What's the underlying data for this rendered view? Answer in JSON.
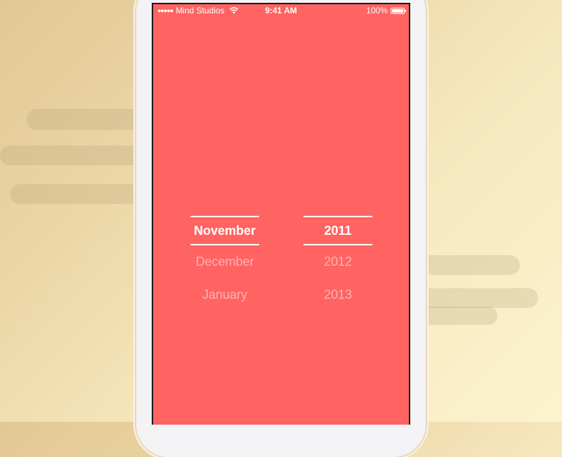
{
  "status_bar": {
    "carrier": "Mind Studios",
    "time": "9:41 AM",
    "battery_percent": "100%",
    "battery_level": 1.0
  },
  "picker": {
    "months": {
      "selected": "November",
      "options": [
        "December",
        "January"
      ]
    },
    "years": {
      "selected": "2011",
      "options": [
        "2012",
        "2013"
      ]
    }
  },
  "colors": {
    "screen_background": "#ff6362",
    "text": "#ffffff"
  },
  "icons": {
    "signal": "signal-dots-icon",
    "wifi": "wifi-icon",
    "battery": "battery-icon"
  }
}
